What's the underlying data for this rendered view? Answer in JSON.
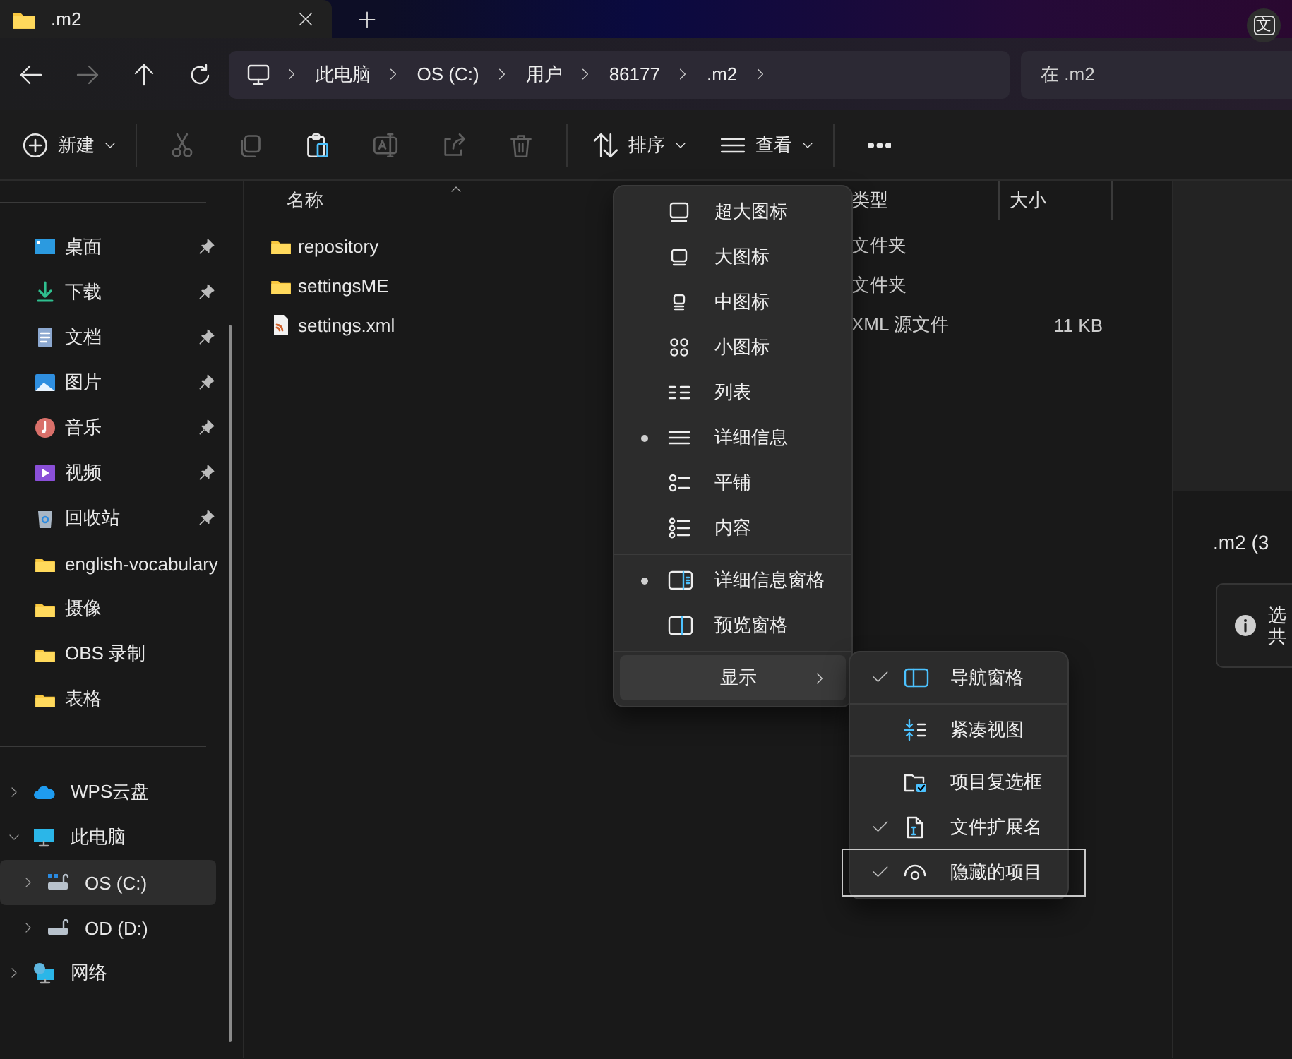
{
  "tab": {
    "title": ".m2"
  },
  "overlay_badge": "文",
  "nav": [
    {
      "kind": "back",
      "disabled": false
    },
    {
      "kind": "forward",
      "disabled": true
    },
    {
      "kind": "up",
      "disabled": false
    },
    {
      "kind": "refresh",
      "disabled": false
    }
  ],
  "breadcrumb": [
    "此电脑",
    "OS (C:)",
    "用户",
    "86177",
    ".m2"
  ],
  "search": {
    "placeholder": "在 .m2"
  },
  "toolbar": {
    "new_label": "新建",
    "actions": [
      {
        "kind": "cut",
        "disabled": true
      },
      {
        "kind": "copy",
        "disabled": true
      },
      {
        "kind": "paste",
        "disabled": false
      },
      {
        "kind": "rename",
        "disabled": true
      },
      {
        "kind": "share",
        "disabled": true
      },
      {
        "kind": "delete",
        "disabled": true
      }
    ],
    "sort_label": "排序",
    "view_label": "查看"
  },
  "sidebar": {
    "quick_access": [
      {
        "label": "桌面",
        "kind": "desktop",
        "pinned": true,
        "selected": false
      },
      {
        "label": "下载",
        "kind": "download",
        "pinned": true,
        "selected": false
      },
      {
        "label": "文档",
        "kind": "documents",
        "pinned": true,
        "selected": false
      },
      {
        "label": "图片",
        "kind": "pictures",
        "pinned": true,
        "selected": false
      },
      {
        "label": "音乐",
        "kind": "music",
        "pinned": true,
        "selected": false
      },
      {
        "label": "视频",
        "kind": "videos",
        "pinned": true,
        "selected": false
      },
      {
        "label": "回收站",
        "kind": "recycle",
        "pinned": true,
        "selected": false
      },
      {
        "label": "english-vocabulary",
        "kind": "folder",
        "pinned": false,
        "selected": false
      },
      {
        "label": "摄像",
        "kind": "folder",
        "pinned": false,
        "selected": false
      },
      {
        "label": "OBS 录制",
        "kind": "folder",
        "pinned": false,
        "selected": false
      },
      {
        "label": "表格",
        "kind": "folder",
        "pinned": false,
        "selected": false
      }
    ],
    "tree": [
      {
        "label": "WPS云盘",
        "kind": "cloud",
        "expanded": false,
        "selected": false
      },
      {
        "label": "此电脑",
        "kind": "pc",
        "expanded": true,
        "selected": false,
        "children": [
          {
            "label": "OS (C:)",
            "kind": "drive-os",
            "expanded": false,
            "selected": true
          },
          {
            "label": "OD (D:)",
            "kind": "drive",
            "expanded": false,
            "selected": false
          }
        ]
      },
      {
        "label": "网络",
        "kind": "network",
        "expanded": false,
        "selected": false
      }
    ]
  },
  "columns": [
    {
      "label": "名称",
      "sorted": true
    },
    {
      "label": "类型",
      "sorted": false
    },
    {
      "label": "大小",
      "sorted": false
    }
  ],
  "files": [
    {
      "name": "repository",
      "kind": "folder",
      "type": "文件夹"
    },
    {
      "name": "settingsME",
      "kind": "folder",
      "type": "文件夹"
    },
    {
      "name": "settings.xml",
      "kind": "xml",
      "type": "XML 源文件",
      "size": "11 KB"
    }
  ],
  "view_menu": {
    "layouts": [
      {
        "label": "超大图标",
        "kind": "xl",
        "selected": false
      },
      {
        "label": "大图标",
        "kind": "large",
        "selected": false
      },
      {
        "label": "中图标",
        "kind": "medium",
        "selected": false
      },
      {
        "label": "小图标",
        "kind": "small",
        "selected": false
      },
      {
        "label": "列表",
        "kind": "list",
        "selected": false
      },
      {
        "label": "详细信息",
        "kind": "details",
        "selected": true
      },
      {
        "label": "平铺",
        "kind": "tiles",
        "selected": false
      },
      {
        "label": "内容",
        "kind": "content",
        "selected": false
      }
    ],
    "panes": [
      {
        "label": "详细信息窗格",
        "kind": "details-pane",
        "on": true
      },
      {
        "label": "预览窗格",
        "kind": "preview-pane",
        "on": false
      }
    ],
    "show": {
      "label": "显示",
      "expanded": true
    }
  },
  "show_menu": [
    [
      {
        "label": "导航窗格",
        "kind": "nav-pane",
        "checked": true,
        "focused": false
      }
    ],
    [
      {
        "label": "紧凑视图",
        "kind": "compact",
        "checked": false,
        "focused": false
      }
    ],
    [
      {
        "label": "项目复选框",
        "kind": "checkboxes",
        "checked": false,
        "focused": false
      },
      {
        "label": "文件扩展名",
        "kind": "extensions",
        "checked": true,
        "focused": false
      },
      {
        "label": "隐藏的项目",
        "kind": "hidden",
        "checked": true,
        "focused": true
      }
    ]
  ],
  "details_pane": {
    "title": ".m2 (3",
    "info_lines": [
      "选",
      "共"
    ]
  }
}
